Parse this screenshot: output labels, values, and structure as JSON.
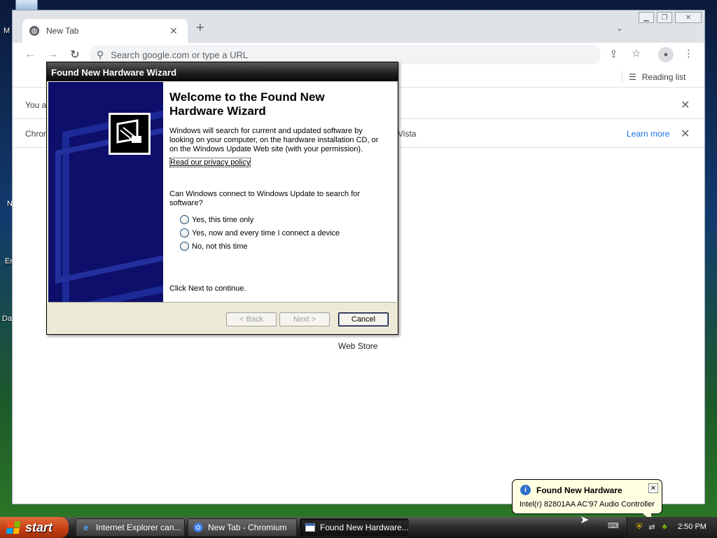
{
  "desktop": {
    "icon_labels": [
      "M",
      "N",
      "Er",
      "Da"
    ]
  },
  "browser": {
    "tab": {
      "title": "New Tab",
      "close_glyph": "✕"
    },
    "new_tab_glyph": "+",
    "tab_search_glyph": "⌄",
    "window_controls": {
      "minimize": "▁",
      "restore": "❐",
      "close": "✕"
    },
    "nav": {
      "back_glyph": "←",
      "forward_glyph": "→",
      "reload_glyph": "↻"
    },
    "omnibox": {
      "placeholder": "Search google.com or type a URL",
      "icon": "search-icon"
    },
    "toolbar_icons": {
      "share": "⇪",
      "star": "☆",
      "profile": "●",
      "menu": "⋮"
    },
    "bookmarks": {
      "reading_list": "Reading list",
      "reading_list_glyph": "☰"
    },
    "infobar1": {
      "text": "You a",
      "close_glyph": "✕"
    },
    "infobar2": {
      "text": "Chron",
      "text2": "Vista",
      "learn_more": "Learn more",
      "close_glyph": "✕"
    },
    "web_store": "Web Store"
  },
  "wizard": {
    "title": "Found New Hardware Wizard",
    "heading": "Welcome to the Found New Hardware Wizard",
    "paragraph": "Windows will search for current and updated software by looking on your computer, on the hardware installation CD, or on the Windows Update Web site (with your permission).",
    "privacy_link": "Read our privacy policy",
    "question": "Can Windows connect to Windows Update to search for software?",
    "options": [
      "Yes, this time only",
      "Yes, now and every time I connect a device",
      "No, not this time"
    ],
    "continue_text": "Click Next to continue.",
    "buttons": {
      "back": "< Back",
      "next": "Next >",
      "cancel": "Cancel"
    }
  },
  "balloon": {
    "title": "Found New Hardware",
    "message": "Intel(r) 82801AA AC'97 Audio Controller",
    "close_glyph": "✕",
    "info_glyph": "i"
  },
  "taskbar": {
    "start_label": "start",
    "tasks": [
      {
        "label": "Internet Explorer can...",
        "icon": "ie-icon"
      },
      {
        "label": "New Tab - Chromium",
        "icon": "chromium-icon"
      },
      {
        "label": "Found New Hardware...",
        "icon": "window-icon"
      }
    ],
    "clock": "2:50 PM"
  },
  "colors": {
    "accent_link": "#1a73e8",
    "wizard_side": "#0d0f6a",
    "balloon_bg": "#ffffe1"
  }
}
